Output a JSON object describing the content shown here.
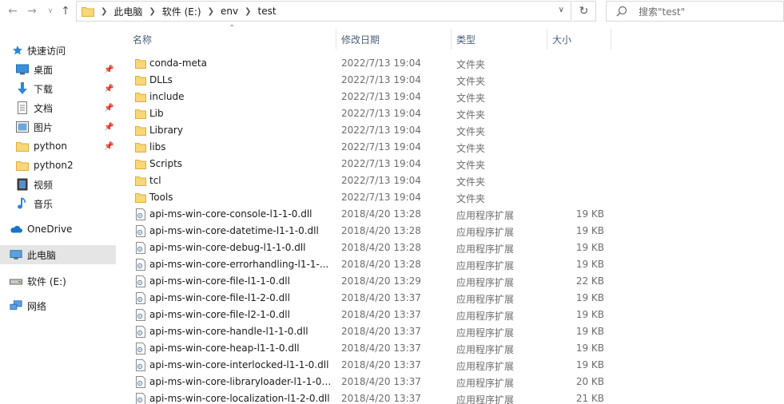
{
  "address": {
    "crumbs": [
      "此电脑",
      "软件 (E:)",
      "env",
      "test"
    ]
  },
  "search": {
    "placeholder": "搜索\"test\""
  },
  "sidebar": {
    "quick_access": "快速访问",
    "items": [
      {
        "label": "桌面",
        "icon": "desktop-icon",
        "pinned": true
      },
      {
        "label": "下载",
        "icon": "download-icon",
        "pinned": true
      },
      {
        "label": "文档",
        "icon": "document-icon",
        "pinned": true
      },
      {
        "label": "图片",
        "icon": "picture-icon",
        "pinned": true
      },
      {
        "label": "python",
        "icon": "folder-icon",
        "pinned": true
      },
      {
        "label": "python2",
        "icon": "folder-icon",
        "pinned": false
      },
      {
        "label": "视频",
        "icon": "video-icon",
        "pinned": false
      },
      {
        "label": "音乐",
        "icon": "music-icon",
        "pinned": false
      }
    ],
    "onedrive": "OneDrive",
    "this_pc": "此电脑",
    "drive": "软件 (E:)",
    "network": "网络"
  },
  "columns": {
    "name": "名称",
    "date": "修改日期",
    "type": "类型",
    "size": "大小"
  },
  "files": [
    {
      "name": "conda-meta",
      "date": "2022/7/13 19:04",
      "type": "文件夹",
      "size": "",
      "kind": "folder"
    },
    {
      "name": "DLLs",
      "date": "2022/7/13 19:04",
      "type": "文件夹",
      "size": "",
      "kind": "folder"
    },
    {
      "name": "include",
      "date": "2022/7/13 19:04",
      "type": "文件夹",
      "size": "",
      "kind": "folder"
    },
    {
      "name": "Lib",
      "date": "2022/7/13 19:04",
      "type": "文件夹",
      "size": "",
      "kind": "folder"
    },
    {
      "name": "Library",
      "date": "2022/7/13 19:04",
      "type": "文件夹",
      "size": "",
      "kind": "folder"
    },
    {
      "name": "libs",
      "date": "2022/7/13 19:04",
      "type": "文件夹",
      "size": "",
      "kind": "folder"
    },
    {
      "name": "Scripts",
      "date": "2022/7/13 19:04",
      "type": "文件夹",
      "size": "",
      "kind": "folder"
    },
    {
      "name": "tcl",
      "date": "2022/7/13 19:04",
      "type": "文件夹",
      "size": "",
      "kind": "folder"
    },
    {
      "name": "Tools",
      "date": "2022/7/13 19:04",
      "type": "文件夹",
      "size": "",
      "kind": "folder"
    },
    {
      "name": "api-ms-win-core-console-l1-1-0.dll",
      "date": "2018/4/20 13:28",
      "type": "应用程序扩展",
      "size": "19 KB",
      "kind": "dll"
    },
    {
      "name": "api-ms-win-core-datetime-l1-1-0.dll",
      "date": "2018/4/20 13:28",
      "type": "应用程序扩展",
      "size": "19 KB",
      "kind": "dll"
    },
    {
      "name": "api-ms-win-core-debug-l1-1-0.dll",
      "date": "2018/4/20 13:28",
      "type": "应用程序扩展",
      "size": "19 KB",
      "kind": "dll"
    },
    {
      "name": "api-ms-win-core-errorhandling-l1-1-...",
      "date": "2018/4/20 13:28",
      "type": "应用程序扩展",
      "size": "19 KB",
      "kind": "dll"
    },
    {
      "name": "api-ms-win-core-file-l1-1-0.dll",
      "date": "2018/4/20 13:29",
      "type": "应用程序扩展",
      "size": "22 KB",
      "kind": "dll"
    },
    {
      "name": "api-ms-win-core-file-l1-2-0.dll",
      "date": "2018/4/20 13:37",
      "type": "应用程序扩展",
      "size": "19 KB",
      "kind": "dll"
    },
    {
      "name": "api-ms-win-core-file-l2-1-0.dll",
      "date": "2018/4/20 13:37",
      "type": "应用程序扩展",
      "size": "19 KB",
      "kind": "dll"
    },
    {
      "name": "api-ms-win-core-handle-l1-1-0.dll",
      "date": "2018/4/20 13:37",
      "type": "应用程序扩展",
      "size": "19 KB",
      "kind": "dll"
    },
    {
      "name": "api-ms-win-core-heap-l1-1-0.dll",
      "date": "2018/4/20 13:37",
      "type": "应用程序扩展",
      "size": "19 KB",
      "kind": "dll"
    },
    {
      "name": "api-ms-win-core-interlocked-l1-1-0.dll",
      "date": "2018/4/20 13:37",
      "type": "应用程序扩展",
      "size": "19 KB",
      "kind": "dll"
    },
    {
      "name": "api-ms-win-core-libraryloader-l1-1-0....",
      "date": "2018/4/20 13:37",
      "type": "应用程序扩展",
      "size": "20 KB",
      "kind": "dll"
    },
    {
      "name": "api-ms-win-core-localization-l1-2-0.dll",
      "date": "2018/4/20 13:37",
      "type": "应用程序扩展",
      "size": "21 KB",
      "kind": "dll"
    }
  ],
  "colors": {
    "folder": "#f8d775",
    "folder_dark": "#e8b94a",
    "header_text": "#4c607a",
    "selected_bg": "#e5e5e5"
  }
}
